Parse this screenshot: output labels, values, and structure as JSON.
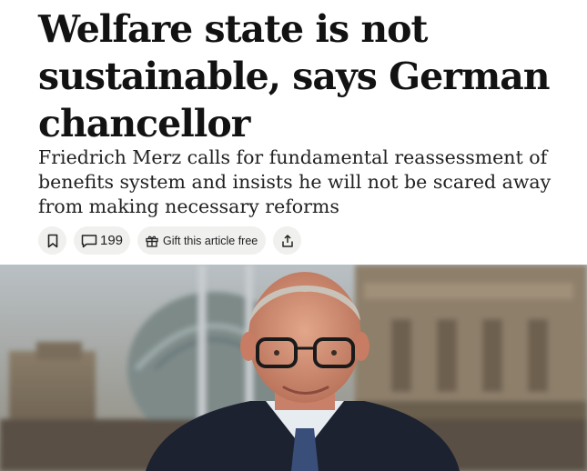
{
  "article": {
    "headline": "Welfare state is not sustainable, says German chancellor",
    "standfirst": "Friedrich Merz calls for fundamental reassessment of benefits system and insists he will not be scared away from making necessary reforms"
  },
  "actions": {
    "bookmark_icon": "bookmark-icon",
    "comments_icon": "comment-icon",
    "comment_count": "199",
    "gift_icon": "gift-icon",
    "gift_label": "Gift this article free",
    "share_icon": "share-icon"
  },
  "hero_image": {
    "subject": "Photo of Friedrich Merz in front of the Reichstag building dome"
  }
}
